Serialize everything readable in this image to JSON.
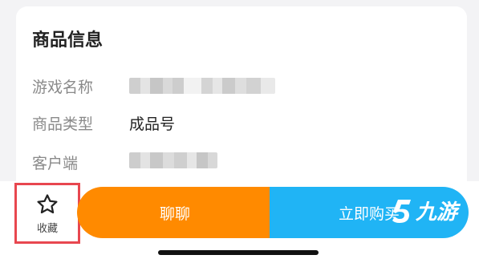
{
  "colors": {
    "chat_button": "#ff8a00",
    "buy_button": "#20b4f5",
    "highlight_box": "#e8474f",
    "card_bg": "#ffffff",
    "page_bg": "#f3f3f5"
  },
  "product_info": {
    "title": "商品信息",
    "rows": [
      {
        "label": "游戏名称",
        "value": ""
      },
      {
        "label": "商品类型",
        "value": "成品号"
      },
      {
        "label": "客户端",
        "value": ""
      }
    ]
  },
  "bottom_bar": {
    "favorite": {
      "icon": "star-icon",
      "label": "收藏"
    },
    "chat_button": "聊聊",
    "buy_button": "立即购买"
  },
  "watermark": {
    "icon": "logo-5-icon",
    "text": "九游"
  }
}
